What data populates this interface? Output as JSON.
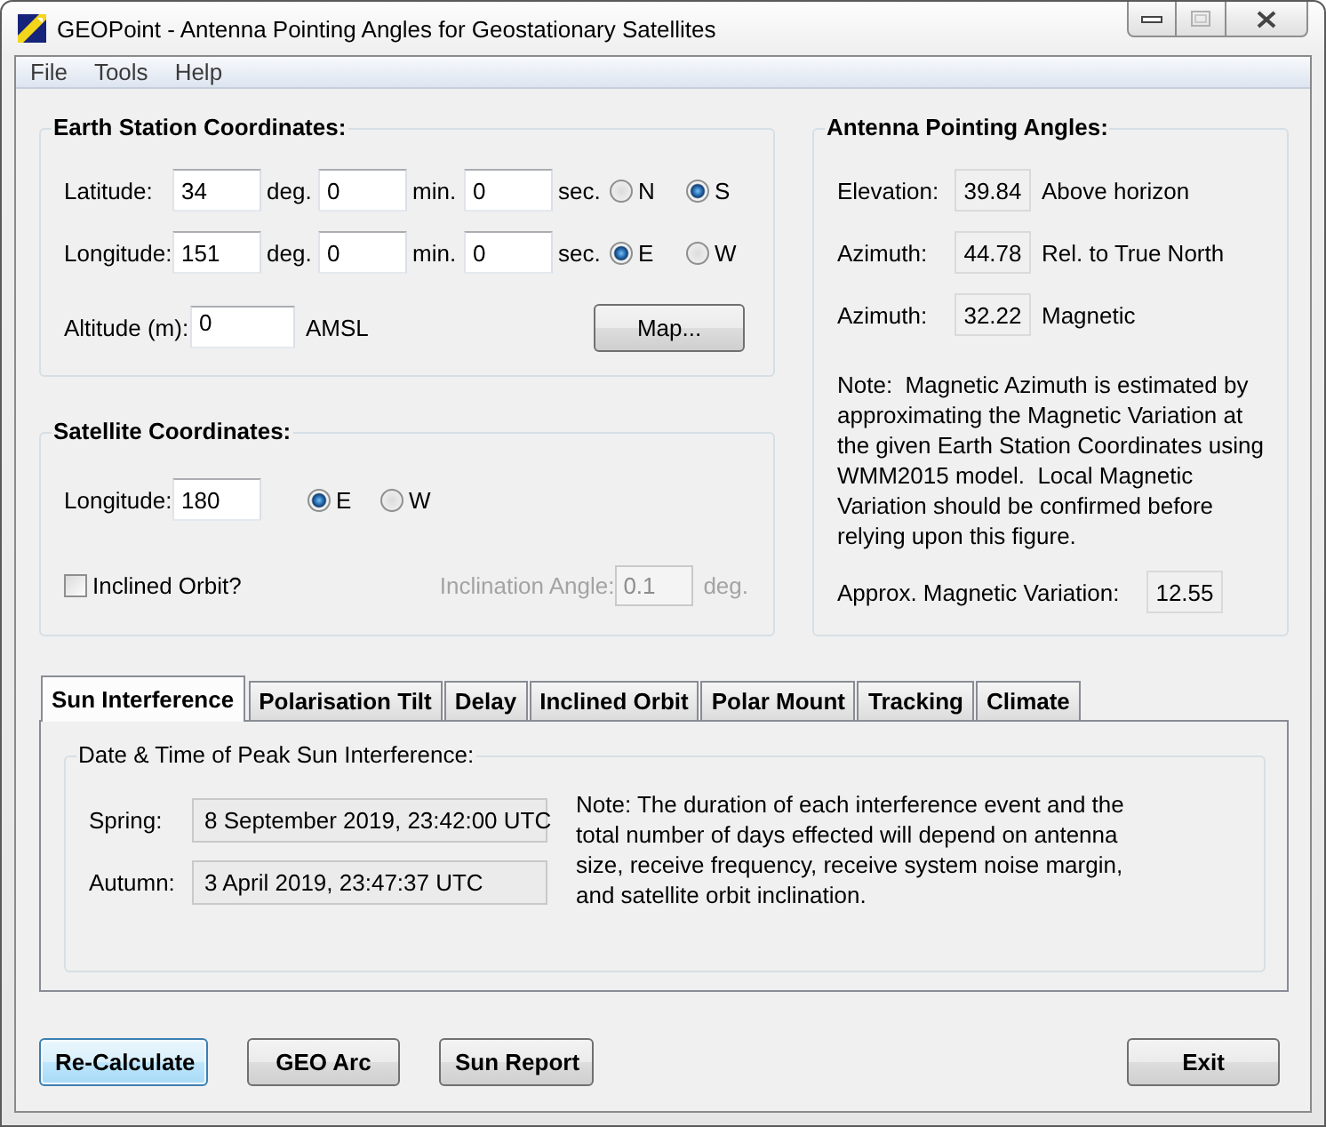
{
  "window": {
    "title": "GEOPoint - Antenna Pointing Angles for Geostationary Satellites"
  },
  "menu": [
    "File",
    "Tools",
    "Help"
  ],
  "earth_station": {
    "title": "Earth Station Coordinates:",
    "rows": [
      {
        "label": "Latitude:",
        "fields": [
          {
            "value": "34",
            "unit": "deg."
          },
          {
            "value": "0",
            "unit": "min."
          },
          {
            "value": "0",
            "unit": "sec."
          }
        ],
        "radios": [
          {
            "label": "N",
            "selected": false
          },
          {
            "label": "S",
            "selected": true
          }
        ]
      },
      {
        "label": "Longitude:",
        "fields": [
          {
            "value": "151",
            "unit": "deg."
          },
          {
            "value": "0",
            "unit": "min."
          },
          {
            "value": "0",
            "unit": "sec."
          }
        ],
        "radios": [
          {
            "label": "E",
            "selected": true
          },
          {
            "label": "W",
            "selected": false
          }
        ]
      }
    ],
    "altitude": {
      "label": "Altitude (m):",
      "value": "0",
      "unit": "AMSL"
    },
    "map_button": "Map..."
  },
  "satellite": {
    "title": "Satellite Coordinates:",
    "longitude": {
      "label": "Longitude:",
      "value": "180",
      "radios": [
        {
          "label": "E",
          "selected": true
        },
        {
          "label": "W",
          "selected": false
        }
      ]
    },
    "inclined_orbit": {
      "label": "Inclined Orbit?",
      "checked": false
    },
    "inclination": {
      "label": "Inclination Angle:",
      "value": "0.1",
      "unit": "deg.",
      "disabled": true
    }
  },
  "pointing_angles": {
    "title": "Antenna Pointing Angles:",
    "rows": [
      {
        "label": "Elevation:",
        "value": "39.84",
        "note": "Above horizon"
      },
      {
        "label": "Azimuth:",
        "value": "44.78",
        "note": "Rel. to True North"
      },
      {
        "label": "Azimuth:",
        "value": "32.22",
        "note": "Magnetic"
      }
    ],
    "note": "Note:  Magnetic Azimuth is estimated by approximating the Magnetic Variation at the given Earth Station Coordinates using WMM2015 model.  Local Magnetic Variation should be confirmed before relying upon this figure.",
    "variation": {
      "label": "Approx. Magnetic Variation:",
      "value": "12.55"
    }
  },
  "tabs": [
    {
      "label": "Sun Interference",
      "selected": true
    },
    {
      "label": "Polarisation Tilt",
      "selected": false
    },
    {
      "label": "Delay",
      "selected": false
    },
    {
      "label": "Inclined Orbit",
      "selected": false
    },
    {
      "label": "Polar Mount",
      "selected": false
    },
    {
      "label": "Tracking",
      "selected": false
    },
    {
      "label": "Climate",
      "selected": false
    }
  ],
  "sun_interference": {
    "title": "Date & Time of Peak Sun Interference:",
    "rows": [
      {
        "label": "Spring:",
        "value": "8 September 2019, 23:42:00 UTC"
      },
      {
        "label": "Autumn:",
        "value": "3 April 2019, 23:47:37 UTC"
      }
    ],
    "note": "Note: The duration of each interference event and the total number of days effected will depend on antenna size, receive frequency, receive system noise margin, and satellite orbit inclination."
  },
  "buttons": [
    {
      "label": "Re-Calculate",
      "focused": true
    },
    {
      "label": "GEO Arc",
      "focused": false
    },
    {
      "label": "Sun Report",
      "focused": false
    }
  ],
  "exit_button": "Exit"
}
